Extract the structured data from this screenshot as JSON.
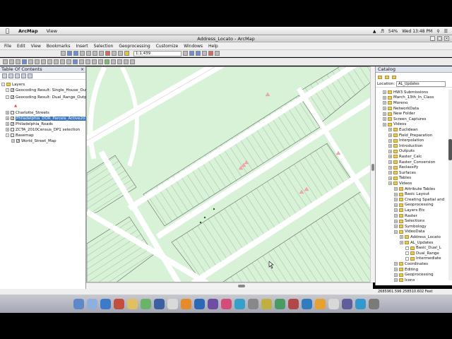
{
  "mac_menu": {
    "app": "ArcMap",
    "view": "View"
  },
  "status": {
    "battery": "54%",
    "clock": "Wed 13:48 PM"
  },
  "window_title": "Address_Locato - ArcMap",
  "app_menu": [
    "File",
    "Edit",
    "View",
    "Bookmarks",
    "Insert",
    "Selection",
    "Geoprocessing",
    "Customize",
    "Windows",
    "Help"
  ],
  "scale": "1:1,439",
  "toc": {
    "title": "Table Of Contents",
    "items": [
      {
        "label": "Layers",
        "checked": true
      },
      {
        "label": "Geocoding Result: Single_House_Output",
        "checked": true
      },
      {
        "label": "Geocoding Result: Dual_Range_Output",
        "checked": true
      },
      {
        "label": "Charlotte_Streets",
        "checked": false
      },
      {
        "label": "Philadelphia_DOR_Parcels_Active201302",
        "checked": true
      },
      {
        "label": "Philadelphia_Roads",
        "checked": true
      },
      {
        "label": "ZCTA_2010Census_DP1 selection",
        "checked": false
      },
      {
        "label": "Basemap",
        "checked": false
      },
      {
        "label": "World_Street_Map",
        "checked": true
      }
    ]
  },
  "catalog": {
    "title": "Catalog",
    "location_label": "Location:",
    "location_value": "AL_Updates",
    "items": [
      {
        "label": "HW3 Submissions",
        "level": 2
      },
      {
        "label": "March_13th_In_Class",
        "level": 2
      },
      {
        "label": "Moreno",
        "level": 2
      },
      {
        "label": "NetworkData",
        "level": 2
      },
      {
        "label": "New Folder",
        "level": 2
      },
      {
        "label": "Screen_Captures",
        "level": 2
      },
      {
        "label": "Videos",
        "level": 2
      },
      {
        "label": "Euclidean",
        "level": 3
      },
      {
        "label": "Field_Preparation",
        "level": 3
      },
      {
        "label": "Interpolation",
        "level": 3
      },
      {
        "label": "Introduction",
        "level": 3
      },
      {
        "label": "Outputs",
        "level": 3
      },
      {
        "label": "Raster_Calc",
        "level": 3
      },
      {
        "label": "Raster_Conversion",
        "level": 3
      },
      {
        "label": "Reclassify",
        "level": 3
      },
      {
        "label": "Surfaces",
        "level": 3
      },
      {
        "label": "Tables",
        "level": 3
      },
      {
        "label": "Videos",
        "level": 3
      },
      {
        "label": "Attribute Tables",
        "level": 4
      },
      {
        "label": "Basic Layout",
        "level": 4
      },
      {
        "label": "Creating Spatial and",
        "level": 4
      },
      {
        "label": "Geoprocessing",
        "level": 4
      },
      {
        "label": "Layers Etc",
        "level": 4
      },
      {
        "label": "Raster",
        "level": 4
      },
      {
        "label": "Selections",
        "level": 4
      },
      {
        "label": "Symbology",
        "level": 4
      },
      {
        "label": "VideoData",
        "level": 4
      },
      {
        "label": "Address_Locato",
        "level": 5
      },
      {
        "label": "AL_Updates",
        "level": 5
      },
      {
        "label": "Basic_Dual_L",
        "level": 6
      },
      {
        "label": "Dual_Range",
        "level": 6
      },
      {
        "label": "Intermediate",
        "level": 6
      },
      {
        "label": "Coordinates",
        "level": 4
      },
      {
        "label": "Editing",
        "level": 4
      },
      {
        "label": "Geoprocessing",
        "level": 4
      },
      {
        "label": "Icons",
        "level": 4
      }
    ]
  },
  "coordinates": "2685961.596  258510.602 Feet"
}
